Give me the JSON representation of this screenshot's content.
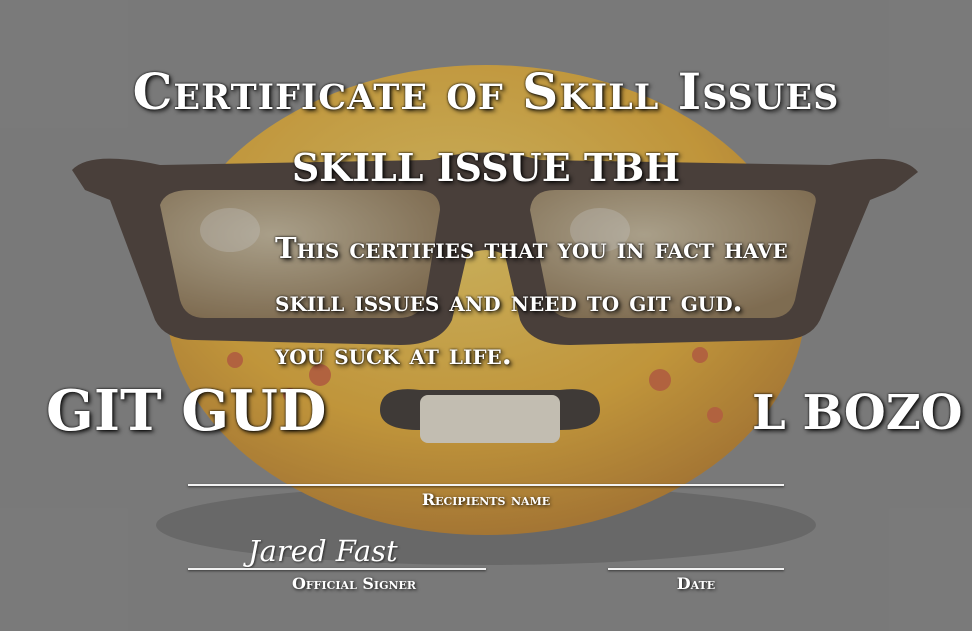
{
  "certificate": {
    "title": "Certificate of Skill Issues",
    "subtitle": "SKILL ISSUE TBH",
    "body": "This certifies that you in fact have skill issues and need to git gud. you suck at life.",
    "left_caption": "GIT GUD",
    "right_caption": "L BOZO",
    "recipient_label": "Recipients name",
    "signer_label": "Official Signer",
    "signature": "Jared Fast",
    "date_label": "Date"
  },
  "colors": {
    "background": "#7b7b7b",
    "text": "#ffffff",
    "emoji_face": "#f2b21a",
    "glasses": "#2a1a12"
  },
  "icons": [
    "nerd-emoji-icon"
  ]
}
